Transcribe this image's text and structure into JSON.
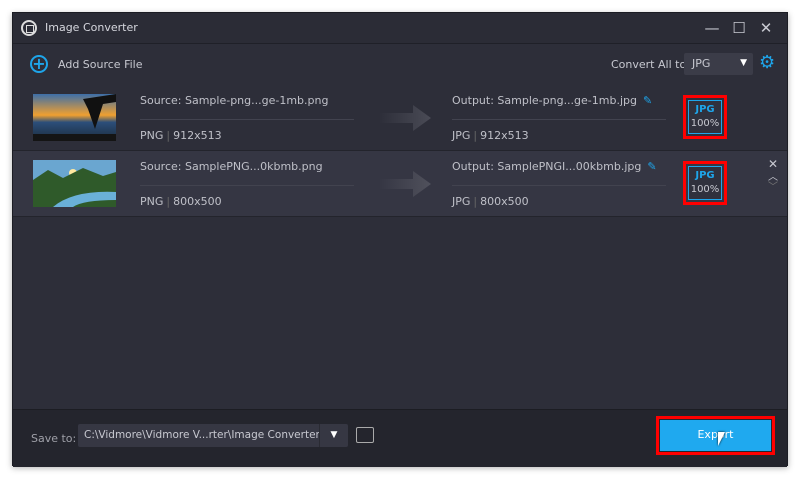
{
  "window": {
    "title": "Image Converter"
  },
  "toolbar": {
    "add_label": "Add Source File",
    "convert_all_label": "Convert All to:",
    "convert_all_value": "JPG"
  },
  "files": [
    {
      "source": "Source: Sample-png...ge-1mb.png",
      "src_format": "PNG",
      "src_size": "912x513",
      "output": "Output: Sample-png...ge-1mb.jpg",
      "out_format": "JPG",
      "out_size": "912x513",
      "badge_format": "JPG",
      "badge_quality": "100%"
    },
    {
      "source": "Source: SamplePNG...0kbmb.png",
      "src_format": "PNG",
      "src_size": "800x500",
      "output": "Output: SamplePNGI...00kbmb.jpg",
      "out_format": "JPG",
      "out_size": "800x500",
      "badge_format": "JPG",
      "badge_quality": "100%"
    }
  ],
  "bottom": {
    "save_label": "Save to:",
    "path": "C:\\Vidmore\\Vidmore V...rter\\Image Converter",
    "export_label": "Export"
  },
  "colors": {
    "accent": "#1ea5ea",
    "highlight": "#ff0000"
  }
}
